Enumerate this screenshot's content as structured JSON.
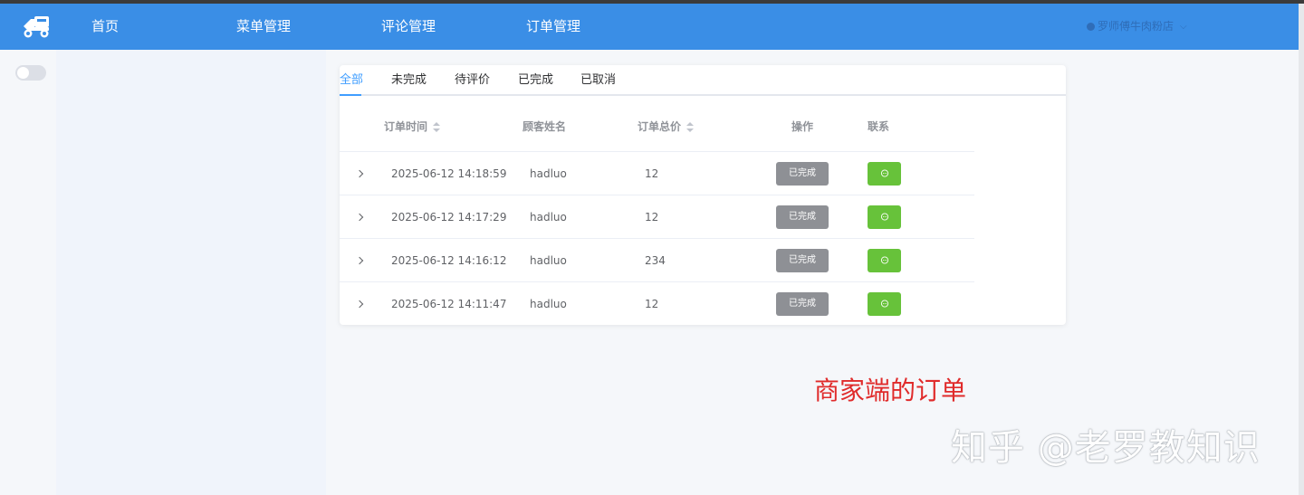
{
  "nav": {
    "items": [
      "首页",
      "菜单管理",
      "评论管理",
      "订单管理"
    ],
    "user": "罗师傅牛肉粉店"
  },
  "tabs": [
    "全部",
    "未完成",
    "待评价",
    "已完成",
    "已取消"
  ],
  "table": {
    "headers": [
      "订单时间",
      "顾客姓名",
      "订单总价",
      "操作",
      "联系"
    ],
    "rows": [
      {
        "time": "2025-06-12 14:18:59",
        "customer": "hadluo",
        "total": "12",
        "status": "已完成"
      },
      {
        "time": "2025-06-12 14:17:29",
        "customer": "hadluo",
        "total": "12",
        "status": "已完成"
      },
      {
        "time": "2025-06-12 14:16:12",
        "customer": "hadluo",
        "total": "234",
        "status": "已完成"
      },
      {
        "time": "2025-06-12 14:11:47",
        "customer": "hadluo",
        "total": "12",
        "status": "已完成"
      }
    ]
  },
  "caption": "商家端的订单",
  "watermark": "知乎 @老罗教知识",
  "colors": {
    "navbar": "#3a8ee6",
    "accent": "#409eff",
    "done_button": "#8e9095",
    "contact_button": "#67c23a",
    "caption": "#e02b2b"
  },
  "icons": {
    "logo": "scooter-logo-icon",
    "expand": "chevron-right-icon",
    "contact": "chat-bubble-icon",
    "user": "user-dot-icon",
    "dropdown": "chevron-down-icon"
  }
}
